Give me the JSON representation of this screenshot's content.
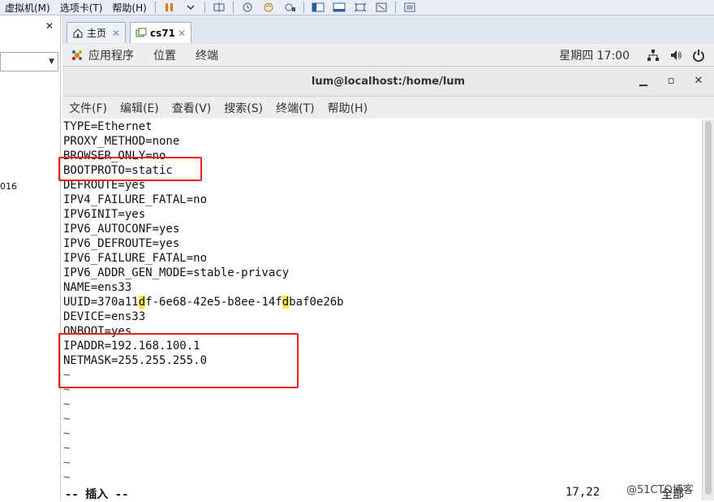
{
  "host_menu": [
    "虚拟机(M)",
    "选项卡(T)",
    "帮助(H)"
  ],
  "left_pane": {
    "close": "✕",
    "partial_text": "016"
  },
  "vm_tabs": [
    {
      "label": "主页",
      "close": "✕"
    },
    {
      "label": "cs71",
      "close": "✕"
    }
  ],
  "gnome_bar": {
    "apps": "应用程序",
    "places": "位置",
    "terminal": "终端",
    "clock": "星期四 17:00"
  },
  "window": {
    "title": "lum@localhost:/home/lum",
    "min": "▁",
    "max": "▫",
    "close": "✕"
  },
  "terminal_menu": [
    "文件(F)",
    "编辑(E)",
    "查看(V)",
    "搜索(S)",
    "终端(T)",
    "帮助(H)"
  ],
  "file_lines": [
    "TYPE=Ethernet",
    "PROXY_METHOD=none",
    "BROWSER_ONLY=no",
    "BOOTPROTO=static",
    "DEFROUTE=yes",
    "IPV4_FAILURE_FATAL=no",
    "IPV6INIT=yes",
    "IPV6_AUTOCONF=yes",
    "IPV6_DEFROUTE=yes",
    "IPV6_FAILURE_FATAL=no",
    "IPV6_ADDR_GEN_MODE=stable-privacy",
    "NAME=ens33",
    "",
    "DEVICE=ens33",
    "ONBOOT=yes",
    "IPADDR=192.168.100.1",
    "NETMASK=255.255.255.0"
  ],
  "uuid": {
    "p1": "UUID=370a11",
    "h1": "d",
    "p2": "f-6e68-42e5-b8ee-14f",
    "h2": "d",
    "p3": "baf0e26b"
  },
  "tilde_lines": [
    "~",
    "~",
    "~",
    "~",
    "~",
    "~",
    "~",
    "~"
  ],
  "status": {
    "mode": "-- 插入 --",
    "position": "17,22",
    "scroll": "全部"
  },
  "watermark": "@51CTO博客",
  "colors": {
    "annotation": "#e8201c",
    "search_highlight": "#f1ec3a"
  }
}
